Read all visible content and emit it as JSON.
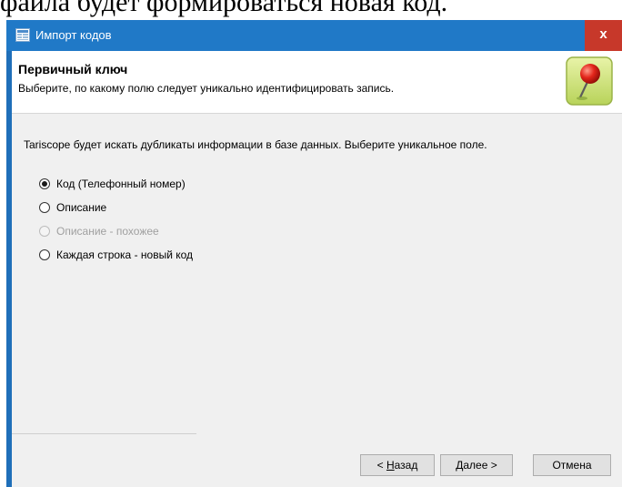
{
  "background_text": "файла будет формироваться новая код.",
  "window": {
    "title": "Импорт кодов",
    "close_label": "x"
  },
  "header": {
    "title": "Первичный ключ",
    "description": "Выберите, по какому полю следует уникально идентифицировать запись.",
    "icon": "map-pin-icon"
  },
  "main": {
    "instruction": "Tariscope будет искать дубликаты информации в базе данных. Выберите уникальное поле.",
    "options": [
      {
        "label": "Код (Телефонный номер)",
        "selected": true,
        "enabled": true
      },
      {
        "label": "Описание",
        "selected": false,
        "enabled": true
      },
      {
        "label": "Описание - похожее",
        "selected": false,
        "enabled": false
      },
      {
        "label": "Каждая строка - новый код",
        "selected": false,
        "enabled": true
      }
    ]
  },
  "buttons": {
    "back_prefix": "< ",
    "back_mnemonic": "Н",
    "back_rest": "азад",
    "next_mnemonic": "Д",
    "next_rest": "алее >",
    "cancel": "Отмена"
  },
  "colors": {
    "titlebar": "#2079c7",
    "close": "#c7382a",
    "client": "#f0f0f0"
  }
}
